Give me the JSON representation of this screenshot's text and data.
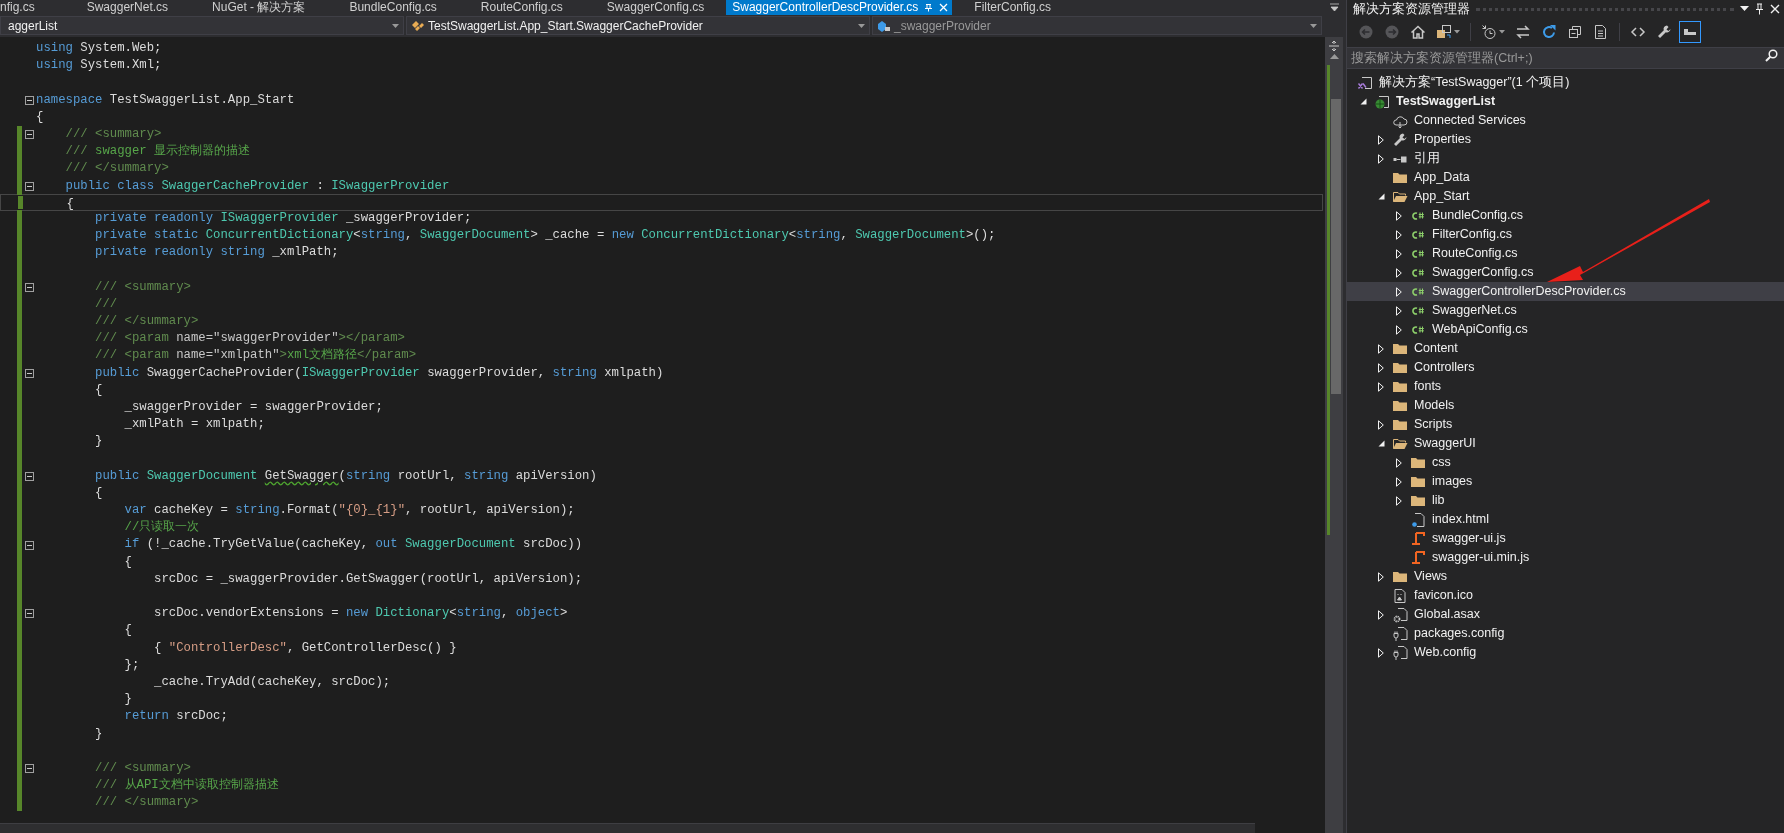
{
  "tabs": [
    {
      "label": "nfig.cs",
      "selected": false
    },
    {
      "label": "SwaggerNet.cs",
      "selected": false
    },
    {
      "label": "NuGet - 解决方案",
      "selected": false
    },
    {
      "label": "BundleConfig.cs",
      "selected": false
    },
    {
      "label": "RouteConfig.cs",
      "selected": false
    },
    {
      "label": "SwaggerConfig.cs",
      "selected": false
    },
    {
      "label": "SwaggerControllerDescProvider.cs",
      "selected": true
    },
    {
      "label": "FilterConfig.cs",
      "selected": false
    }
  ],
  "navigation": {
    "project": "aggerList",
    "type": "TestSwaggerList.App_Start.SwaggerCacheProvider",
    "member": "_swaggerProvider"
  },
  "code": {
    "lines": [
      {
        "fold": false,
        "changed": false,
        "current": false,
        "tokens": [
          {
            "kind": "kw",
            "text": "using"
          },
          {
            "kind": "plain",
            "text": " System.Web;"
          }
        ]
      },
      {
        "fold": false,
        "changed": false,
        "current": false,
        "tokens": [
          {
            "kind": "kw",
            "text": "using"
          },
          {
            "kind": "plain",
            "text": " System.Xml;"
          }
        ]
      },
      {
        "fold": false,
        "changed": false,
        "current": false
      },
      {
        "fold": true,
        "changed": false,
        "current": false,
        "tokens": [
          {
            "kind": "kw",
            "text": "namespace"
          },
          {
            "kind": "plain",
            "text": " TestSwaggerList.App_Start"
          }
        ]
      },
      {
        "fold": false,
        "changed": false,
        "current": false,
        "tokens": [
          {
            "kind": "plain",
            "text": "{"
          }
        ]
      },
      {
        "fold": true,
        "changed": true,
        "current": false,
        "tokens": [
          {
            "kind": "doc",
            "text": "    /// <summary>"
          }
        ]
      },
      {
        "fold": false,
        "changed": true,
        "current": false,
        "tokens": [
          {
            "kind": "doc",
            "text": "    ///"
          },
          {
            "kind": "comment",
            "text": " swagger 显示控制器的描述"
          }
        ]
      },
      {
        "fold": false,
        "changed": true,
        "current": false,
        "tokens": [
          {
            "kind": "doc",
            "text": "    /// </summary>"
          }
        ]
      },
      {
        "fold": true,
        "changed": true,
        "current": false,
        "tokens": [
          {
            "kind": "kw",
            "text": "    public class "
          },
          {
            "kind": "type",
            "text": "SwaggerCacheProvider"
          },
          {
            "kind": "plain",
            "text": " : "
          },
          {
            "kind": "type",
            "text": "ISwaggerProvider"
          }
        ]
      },
      {
        "fold": false,
        "changed": true,
        "current": true,
        "tokens": [
          {
            "kind": "plain",
            "text": "    {"
          }
        ]
      },
      {
        "fold": false,
        "changed": true,
        "current": false,
        "tokens": [
          {
            "kind": "kw",
            "text": "        private readonly "
          },
          {
            "kind": "type",
            "text": "ISwaggerProvider"
          },
          {
            "kind": "plain",
            "text": " _swaggerProvider;"
          }
        ]
      },
      {
        "fold": false,
        "changed": true,
        "current": false,
        "tokens": [
          {
            "kind": "kw",
            "text": "        private static "
          },
          {
            "kind": "type",
            "text": "ConcurrentDictionary"
          },
          {
            "kind": "plain",
            "text": "<"
          },
          {
            "kind": "kw",
            "text": "string"
          },
          {
            "kind": "plain",
            "text": ", "
          },
          {
            "kind": "type",
            "text": "SwaggerDocument"
          },
          {
            "kind": "plain",
            "text": "> _cache = "
          },
          {
            "kind": "kw",
            "text": "new "
          },
          {
            "kind": "type",
            "text": "ConcurrentDictionary"
          },
          {
            "kind": "plain",
            "text": "<"
          },
          {
            "kind": "kw",
            "text": "string"
          },
          {
            "kind": "plain",
            "text": ", "
          },
          {
            "kind": "type",
            "text": "SwaggerDocument"
          },
          {
            "kind": "plain",
            "text": ">();"
          }
        ]
      },
      {
        "fold": false,
        "changed": true,
        "current": false,
        "tokens": [
          {
            "kind": "kw",
            "text": "        private readonly string"
          },
          {
            "kind": "plain",
            "text": " _xmlPath;"
          }
        ]
      },
      {
        "fold": false,
        "changed": true,
        "current": false
      },
      {
        "fold": true,
        "changed": true,
        "current": false,
        "tokens": [
          {
            "kind": "doc",
            "text": "        /// <summary>"
          }
        ]
      },
      {
        "fold": false,
        "changed": true,
        "current": false,
        "tokens": [
          {
            "kind": "doc",
            "text": "        ///"
          }
        ]
      },
      {
        "fold": false,
        "changed": true,
        "current": false,
        "tokens": [
          {
            "kind": "doc",
            "text": "        /// </summary>"
          }
        ]
      },
      {
        "fold": false,
        "changed": true,
        "current": false,
        "tokens": [
          {
            "kind": "doc",
            "text": "        /// <param "
          },
          {
            "kind": "attr",
            "text": "name=\"swaggerProvider\""
          },
          {
            "kind": "doc",
            "text": "></param>"
          }
        ]
      },
      {
        "fold": false,
        "changed": true,
        "current": false,
        "tokens": [
          {
            "kind": "doc",
            "text": "        /// <param "
          },
          {
            "kind": "attr",
            "text": "name=\"xmlpath\""
          },
          {
            "kind": "doc",
            "text": ">"
          },
          {
            "kind": "comment",
            "text": "xml文档路径"
          },
          {
            "kind": "doc",
            "text": "</param>"
          }
        ]
      },
      {
        "fold": true,
        "changed": true,
        "current": false,
        "tokens": [
          {
            "kind": "kw",
            "text": "        public"
          },
          {
            "kind": "plain",
            "text": " SwaggerCacheProvider("
          },
          {
            "kind": "type",
            "text": "ISwaggerProvider"
          },
          {
            "kind": "plain",
            "text": " swaggerProvider, "
          },
          {
            "kind": "kw",
            "text": "string"
          },
          {
            "kind": "plain",
            "text": " xmlpath)"
          }
        ]
      },
      {
        "fold": false,
        "changed": true,
        "current": false,
        "tokens": [
          {
            "kind": "plain",
            "text": "        {"
          }
        ]
      },
      {
        "fold": false,
        "changed": true,
        "current": false,
        "tokens": [
          {
            "kind": "plain",
            "text": "            _swaggerProvider = swaggerProvider;"
          }
        ]
      },
      {
        "fold": false,
        "changed": true,
        "current": false,
        "tokens": [
          {
            "kind": "plain",
            "text": "            _xmlPath = xmlpath;"
          }
        ]
      },
      {
        "fold": false,
        "changed": true,
        "current": false,
        "tokens": [
          {
            "kind": "plain",
            "text": "        }"
          }
        ]
      },
      {
        "fold": false,
        "changed": true,
        "current": false
      },
      {
        "fold": true,
        "changed": true,
        "current": false,
        "tokens": [
          {
            "kind": "kw",
            "text": "        public "
          },
          {
            "kind": "type",
            "text": "SwaggerDocument "
          },
          {
            "kind": "plain",
            "text": "GetSwagger",
            "squiggle": true
          },
          {
            "kind": "plain",
            "text": "("
          },
          {
            "kind": "kw",
            "text": "string"
          },
          {
            "kind": "plain",
            "text": " rootUrl, "
          },
          {
            "kind": "kw",
            "text": "string"
          },
          {
            "kind": "plain",
            "text": " apiVersion)"
          }
        ]
      },
      {
        "fold": false,
        "changed": true,
        "current": false,
        "tokens": [
          {
            "kind": "plain",
            "text": "        {"
          }
        ]
      },
      {
        "fold": false,
        "changed": true,
        "current": false,
        "tokens": [
          {
            "kind": "kw",
            "text": "            var"
          },
          {
            "kind": "plain",
            "text": " cacheKey = "
          },
          {
            "kind": "kw",
            "text": "string"
          },
          {
            "kind": "plain",
            "text": ".Format("
          },
          {
            "kind": "string",
            "text": "\"{0}_{1}\""
          },
          {
            "kind": "plain",
            "text": ", rootUrl, apiVersion);"
          }
        ]
      },
      {
        "fold": false,
        "changed": true,
        "current": false,
        "tokens": [
          {
            "kind": "comment",
            "text": "            //只读取一次"
          }
        ]
      },
      {
        "fold": true,
        "changed": true,
        "current": false,
        "tokens": [
          {
            "kind": "kw",
            "text": "            if"
          },
          {
            "kind": "plain",
            "text": " (!_cache.TryGetValue(cacheKey, "
          },
          {
            "kind": "kw",
            "text": "out "
          },
          {
            "kind": "type",
            "text": "SwaggerDocument"
          },
          {
            "kind": "plain",
            "text": " srcDoc))"
          }
        ]
      },
      {
        "fold": false,
        "changed": true,
        "current": false,
        "tokens": [
          {
            "kind": "plain",
            "text": "            {"
          }
        ]
      },
      {
        "fold": false,
        "changed": true,
        "current": false,
        "tokens": [
          {
            "kind": "plain",
            "text": "                srcDoc = _swaggerProvider.GetSwagger(rootUrl, apiVersion);"
          }
        ]
      },
      {
        "fold": false,
        "changed": true,
        "current": false
      },
      {
        "fold": true,
        "changed": true,
        "current": false,
        "tokens": [
          {
            "kind": "plain",
            "text": "                srcDoc.vendorExtensions = "
          },
          {
            "kind": "kw",
            "text": "new "
          },
          {
            "kind": "type",
            "text": "Dictionary"
          },
          {
            "kind": "plain",
            "text": "<"
          },
          {
            "kind": "kw",
            "text": "string"
          },
          {
            "kind": "plain",
            "text": ", "
          },
          {
            "kind": "kw",
            "text": "object"
          },
          {
            "kind": "plain",
            "text": ">"
          }
        ]
      },
      {
        "fold": false,
        "changed": true,
        "current": false,
        "tokens": [
          {
            "kind": "plain",
            "text": "            {"
          }
        ]
      },
      {
        "fold": false,
        "changed": true,
        "current": false,
        "tokens": [
          {
            "kind": "plain",
            "text": "                { "
          },
          {
            "kind": "string",
            "text": "\"ControllerDesc\""
          },
          {
            "kind": "plain",
            "text": ", GetControllerDesc() }"
          }
        ]
      },
      {
        "fold": false,
        "changed": true,
        "current": false,
        "tokens": [
          {
            "kind": "plain",
            "text": "            };"
          }
        ]
      },
      {
        "fold": false,
        "changed": true,
        "current": false,
        "tokens": [
          {
            "kind": "plain",
            "text": "                _cache.TryAdd(cacheKey, srcDoc);"
          }
        ]
      },
      {
        "fold": false,
        "changed": true,
        "current": false,
        "tokens": [
          {
            "kind": "plain",
            "text": "            }"
          }
        ]
      },
      {
        "fold": false,
        "changed": true,
        "current": false,
        "tokens": [
          {
            "kind": "kw",
            "text": "            return"
          },
          {
            "kind": "plain",
            "text": " srcDoc;"
          }
        ]
      },
      {
        "fold": false,
        "changed": true,
        "current": false,
        "tokens": [
          {
            "kind": "plain",
            "text": "        }"
          }
        ]
      },
      {
        "fold": false,
        "changed": true,
        "current": false
      },
      {
        "fold": true,
        "changed": true,
        "current": false,
        "tokens": [
          {
            "kind": "doc",
            "text": "        /// <summary>"
          }
        ]
      },
      {
        "fold": false,
        "changed": true,
        "current": false,
        "tokens": [
          {
            "kind": "doc",
            "text": "        ///"
          },
          {
            "kind": "comment",
            "text": " 从API文档中读取控制器描述"
          }
        ]
      },
      {
        "fold": false,
        "changed": true,
        "current": false,
        "tokens": [
          {
            "kind": "doc",
            "text": "        /// </summary>"
          }
        ]
      }
    ]
  },
  "solution_explorer": {
    "title": "解决方案资源管理器",
    "toolbar": {
      "groups": [
        {
          "buttons": [
            {
              "kind": "back",
              "disabled": true,
              "on": false,
              "dropdown": false
            },
            {
              "kind": "forward",
              "disabled": true,
              "on": false,
              "dropdown": false
            },
            {
              "kind": "home",
              "disabled": false,
              "on": false,
              "dropdown": false
            },
            {
              "kind": "switch_views",
              "disabled": false,
              "on": false,
              "dropdown": true
            }
          ]
        },
        {
          "buttons": [
            {
              "kind": "pending_changes",
              "disabled": false,
              "on": false,
              "dropdown": true
            },
            {
              "kind": "sync",
              "disabled": false,
              "on": false,
              "dropdown": false
            },
            {
              "kind": "refresh",
              "disabled": false,
              "on": false,
              "dropdown": false
            },
            {
              "kind": "collapse_all",
              "disabled": false,
              "on": false,
              "dropdown": false
            },
            {
              "kind": "show_all_files",
              "disabled": false,
              "on": false,
              "dropdown": false
            }
          ]
        },
        {
          "buttons": [
            {
              "kind": "view_code",
              "disabled": false,
              "on": false,
              "dropdown": false
            },
            {
              "kind": "properties",
              "disabled": false,
              "on": false,
              "dropdown": false
            },
            {
              "kind": "preview",
              "disabled": false,
              "on": true,
              "dropdown": false
            }
          ]
        }
      ]
    },
    "search": {
      "placeholder": "搜索解决方案资源管理器(Ctrl+;)"
    },
    "solution": {
      "label": "解决方案“TestSwagger”(1 个项目)"
    },
    "projects": [
      {
        "label": "TestSwaggerList",
        "kind": "project",
        "expandable": true,
        "expanded": true,
        "selected": false,
        "startup": true,
        "children": [
          {
            "label": "Connected Services",
            "kind": "connected",
            "expandable": false,
            "expanded": false,
            "selected": false
          },
          {
            "label": "Properties",
            "kind": "properties",
            "expandable": true,
            "expanded": false,
            "selected": false
          },
          {
            "label": "引用",
            "kind": "references",
            "expandable": true,
            "expanded": false,
            "selected": false
          },
          {
            "label": "App_Data",
            "kind": "folder",
            "expandable": false,
            "expanded": false,
            "selected": false
          },
          {
            "label": "App_Start",
            "kind": "folder",
            "expandable": true,
            "expanded": true,
            "selected": false,
            "children": [
              {
                "label": "BundleConfig.cs",
                "kind": "cs",
                "expandable": true,
                "expanded": false,
                "selected": false
              },
              {
                "label": "FilterConfig.cs",
                "kind": "cs",
                "expandable": true,
                "expanded": false,
                "selected": false
              },
              {
                "label": "RouteConfig.cs",
                "kind": "cs",
                "expandable": true,
                "expanded": false,
                "selected": false
              },
              {
                "label": "SwaggerConfig.cs",
                "kind": "cs",
                "expandable": true,
                "expanded": false,
                "selected": false
              },
              {
                "label": "SwaggerControllerDescProvider.cs",
                "kind": "cs",
                "expandable": true,
                "expanded": false,
                "selected": true
              },
              {
                "label": "SwaggerNet.cs",
                "kind": "cs",
                "expandable": true,
                "expanded": false,
                "selected": false
              },
              {
                "label": "WebApiConfig.cs",
                "kind": "cs",
                "expandable": true,
                "expanded": false,
                "selected": false
              }
            ]
          },
          {
            "label": "Content",
            "kind": "folder",
            "expandable": true,
            "expanded": false,
            "selected": false
          },
          {
            "label": "Controllers",
            "kind": "folder",
            "expandable": true,
            "expanded": false,
            "selected": false
          },
          {
            "label": "fonts",
            "kind": "folder",
            "expandable": true,
            "expanded": false,
            "selected": false
          },
          {
            "label": "Models",
            "kind": "folder",
            "expandable": false,
            "expanded": false,
            "selected": false
          },
          {
            "label": "Scripts",
            "kind": "folder",
            "expandable": true,
            "expanded": false,
            "selected": false
          },
          {
            "label": "SwaggerUI",
            "kind": "folder",
            "expandable": true,
            "expanded": true,
            "selected": false,
            "children": [
              {
                "label": "css",
                "kind": "folder",
                "expandable": true,
                "expanded": false,
                "selected": false
              },
              {
                "label": "images",
                "kind": "folder",
                "expandable": true,
                "expanded": false,
                "selected": false
              },
              {
                "label": "lib",
                "kind": "folder",
                "expandable": true,
                "expanded": false,
                "selected": false
              },
              {
                "label": "index.html",
                "kind": "html",
                "expandable": false,
                "expanded": false,
                "selected": false
              },
              {
                "label": "swagger-ui.js",
                "kind": "js",
                "expandable": false,
                "expanded": false,
                "selected": false
              },
              {
                "label": "swagger-ui.min.js",
                "kind": "js",
                "expandable": false,
                "expanded": false,
                "selected": false
              }
            ]
          },
          {
            "label": "Views",
            "kind": "folder",
            "expandable": true,
            "expanded": false,
            "selected": false
          },
          {
            "label": "favicon.ico",
            "kind": "ico",
            "expandable": false,
            "expanded": false,
            "selected": false
          },
          {
            "label": "Global.asax",
            "kind": "asax",
            "expandable": true,
            "expanded": false,
            "selected": false
          },
          {
            "label": "packages.config",
            "kind": "config",
            "expandable": false,
            "expanded": false,
            "selected": false
          },
          {
            "label": "Web.config",
            "kind": "config",
            "expandable": true,
            "expanded": false,
            "selected": false
          }
        ]
      }
    ]
  }
}
